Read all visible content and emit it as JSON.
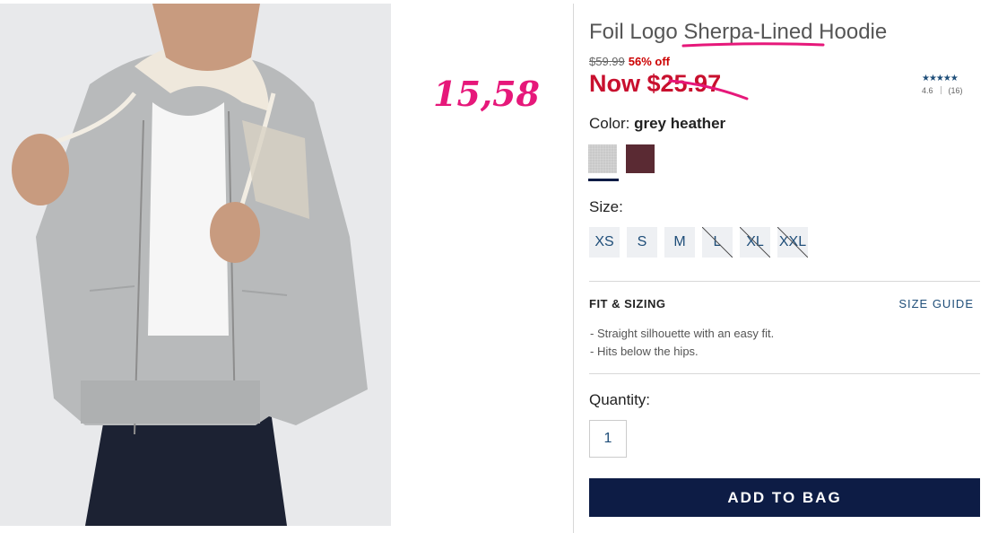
{
  "annotation": {
    "handwritten_price": "15,58"
  },
  "product": {
    "title_before": "Foil Logo ",
    "title_highlight": "Sherpa-Lined",
    "title_after": " Hoodie",
    "was_price": "$59.99",
    "discount": "56% off",
    "now_prefix": "Now ",
    "now_price": "$25.97",
    "rating": {
      "stars_text": "★★★★★",
      "score": "4.6",
      "count": "(16)"
    }
  },
  "color": {
    "label": "Color:",
    "selected": "grey heather",
    "swatches": [
      {
        "name": "grey heather",
        "hex": "#c9c9c9",
        "selected": true
      },
      {
        "name": "burgundy",
        "hex": "#5a2a33",
        "selected": false
      }
    ]
  },
  "size": {
    "label": "Size:",
    "options": [
      {
        "label": "XS",
        "available": true
      },
      {
        "label": "S",
        "available": true
      },
      {
        "label": "M",
        "available": true
      },
      {
        "label": "L",
        "available": false
      },
      {
        "label": "XL",
        "available": false
      },
      {
        "label": "XXL",
        "available": false
      }
    ]
  },
  "fit": {
    "heading": "FIT & SIZING",
    "guide_link": "SIZE GUIDE",
    "bullets": [
      "- Straight silhouette with an easy fit.",
      "- Hits below the hips."
    ]
  },
  "quantity": {
    "label": "Quantity:",
    "value": "1"
  },
  "cta": {
    "label": "ADD TO BAG"
  },
  "colors": {
    "brand_navy": "#0d1c45",
    "sale_red": "#c8102e",
    "annotation_pink": "#e6187a"
  }
}
